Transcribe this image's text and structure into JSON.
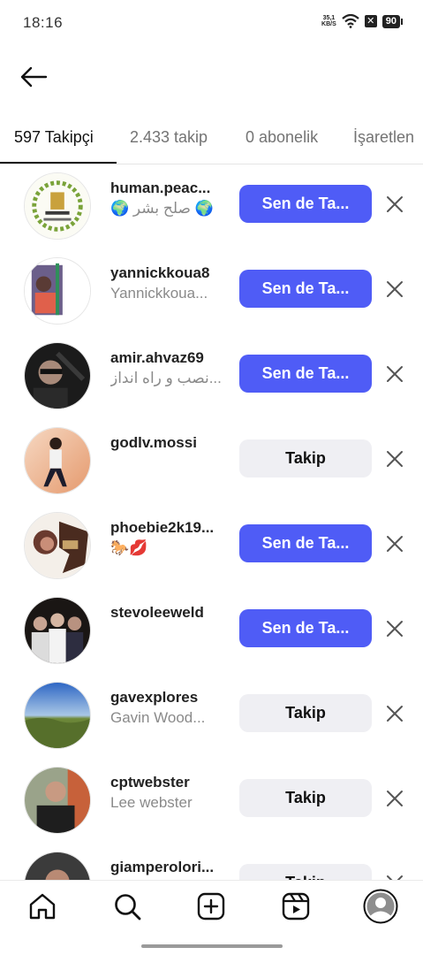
{
  "status_bar": {
    "time": "18:16",
    "net_speed_value": "35,1",
    "net_speed_unit": "KB/S",
    "battery": "90"
  },
  "tabs": [
    {
      "label": "597 Takipçi",
      "active": true
    },
    {
      "label": "2.433 takip",
      "active": false
    },
    {
      "label": "0 abonelik",
      "active": false
    },
    {
      "label": "İşaretlen",
      "active": false
    }
  ],
  "followers": [
    {
      "username": "human.peac...",
      "fullname": "🌍 صلح بشر 🌍",
      "button": "Sen de Ta...",
      "button_style": "primary"
    },
    {
      "username": "yannickkoua8",
      "fullname": "Yannickkoua...",
      "button": "Sen de Ta...",
      "button_style": "primary"
    },
    {
      "username": "amir.ahvaz69",
      "fullname": "نصب  و راه انداز...",
      "button": "Sen de Ta...",
      "button_style": "primary"
    },
    {
      "username": "godlv.mossi",
      "fullname": "",
      "button": "Takip",
      "button_style": "secondary"
    },
    {
      "username": "phoebie2k19...",
      "fullname": "🐎💋",
      "button": "Sen de Ta...",
      "button_style": "primary"
    },
    {
      "username": "stevoleeweld",
      "fullname": "",
      "button": "Sen de Ta...",
      "button_style": "primary"
    },
    {
      "username": "gavexplores",
      "fullname": "Gavin Wood...",
      "button": "Takip",
      "button_style": "secondary"
    },
    {
      "username": "cptwebster",
      "fullname": "Lee webster",
      "button": "Takip",
      "button_style": "secondary"
    },
    {
      "username": "giamperolori...",
      "fullname": "",
      "button": "Takip",
      "button_style": "secondary"
    }
  ],
  "bottom_nav": [
    {
      "icon": "home-icon"
    },
    {
      "icon": "search-icon"
    },
    {
      "icon": "create-icon"
    },
    {
      "icon": "reels-icon"
    },
    {
      "icon": "profile-icon"
    }
  ],
  "colors": {
    "primary_button": "#4f5cf6",
    "secondary_button": "#efeff3"
  }
}
